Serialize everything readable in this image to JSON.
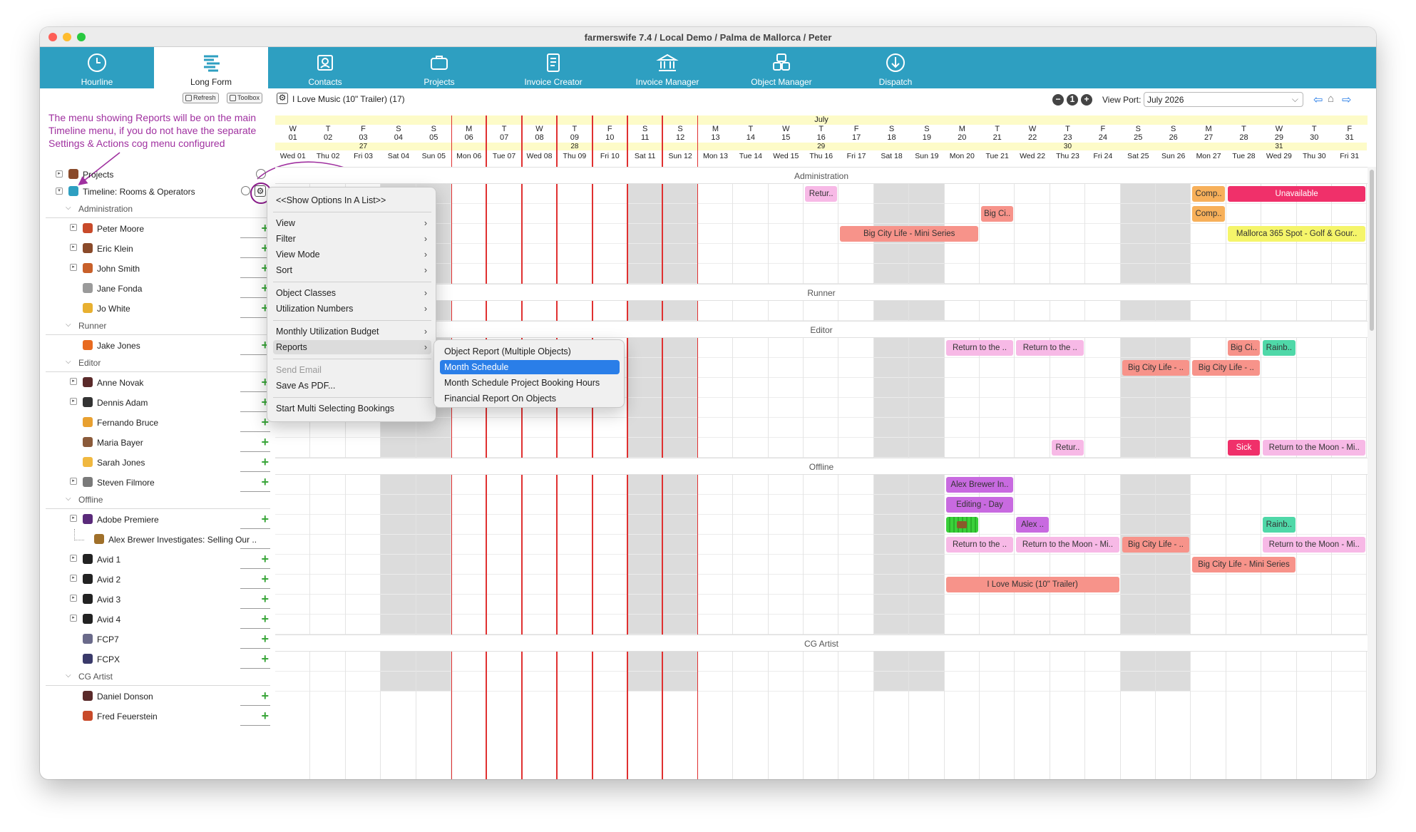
{
  "window": {
    "title": "farmerswife 7.4   / Local Demo / Palma de Mallorca / Peter"
  },
  "tabs": [
    {
      "label": "Hourline",
      "icon": "clock-icon",
      "active": false
    },
    {
      "label": "Long Form",
      "icon": "timeline-icon",
      "active": true
    },
    {
      "label": "Contacts",
      "icon": "contacts-icon",
      "active": false
    },
    {
      "label": "Projects",
      "icon": "briefcase-icon",
      "active": false
    },
    {
      "label": "Invoice Creator",
      "icon": "invoice-icon",
      "active": false
    },
    {
      "label": "Invoice Manager",
      "icon": "bank-icon",
      "active": false
    },
    {
      "label": "Object Manager",
      "icon": "objects-icon",
      "active": false
    },
    {
      "label": "Dispatch",
      "icon": "dispatch-icon",
      "active": false
    }
  ],
  "toolbar": {
    "refresh_label": "Refresh",
    "toolbox_label": "Toolbox",
    "project_label": "I Love Music (10\" Trailer) (17)",
    "viewport_label": "View Port:",
    "viewport_value": "July 2026"
  },
  "annotation": "The menu showing Reports will be on the main Timeline menu, if you do not have the separate Settings & Actions cog menu configured",
  "tree": {
    "projects_label": "Projects",
    "timeline_label": "Timeline: Rooms & Operators"
  },
  "rows": [
    {
      "type": "group",
      "label": "Administration"
    },
    {
      "type": "item",
      "label": "Peter Moore",
      "disc": true,
      "avatar": "#c84a2a"
    },
    {
      "type": "item",
      "label": "Eric Klein",
      "disc": true,
      "avatar": "#8a4a2a"
    },
    {
      "type": "item",
      "label": "John Smith",
      "disc": true,
      "avatar": "#c8602a"
    },
    {
      "type": "item",
      "label": "Jane Fonda",
      "disc": false,
      "avatar": "#9a9a9a"
    },
    {
      "type": "item",
      "label": "Jo White",
      "disc": false,
      "avatar": "#e8b030"
    },
    {
      "type": "group",
      "label": "Runner"
    },
    {
      "type": "item",
      "label": "Jake Jones",
      "disc": false,
      "avatar": "#e86a20"
    },
    {
      "type": "group",
      "label": "Editor"
    },
    {
      "type": "item",
      "label": "Anne Novak",
      "disc": true,
      "avatar": "#5a2a2a"
    },
    {
      "type": "item",
      "label": "Dennis Adam",
      "disc": true,
      "avatar": "#333333"
    },
    {
      "type": "item",
      "label": "Fernando Bruce",
      "disc": false,
      "avatar": "#e8a030"
    },
    {
      "type": "item",
      "label": "Maria Bayer",
      "disc": false,
      "avatar": "#8a5a3a"
    },
    {
      "type": "item",
      "label": "Sarah Jones",
      "disc": false,
      "avatar": "#f0b840"
    },
    {
      "type": "item",
      "label": "Steven Filmore",
      "disc": true,
      "avatar": "#7a7a7a"
    },
    {
      "type": "group",
      "label": "Offline"
    },
    {
      "type": "item",
      "label": "Adobe Premiere",
      "disc": true,
      "avatar": "#5a2a7a"
    },
    {
      "type": "sub",
      "label": "Alex Brewer Investigates: Selling Our ..",
      "disc": false,
      "avatar": "#a0702a"
    },
    {
      "type": "item",
      "label": "Avid 1",
      "disc": true,
      "avatar": "#222222"
    },
    {
      "type": "item",
      "label": "Avid 2",
      "disc": true,
      "avatar": "#222222"
    },
    {
      "type": "item",
      "label": "Avid 3",
      "disc": true,
      "avatar": "#222222"
    },
    {
      "type": "item",
      "label": "Avid 4",
      "disc": true,
      "avatar": "#222222"
    },
    {
      "type": "item",
      "label": "FCP7",
      "disc": false,
      "avatar": "#6a6a8a"
    },
    {
      "type": "item",
      "label": "FCPX",
      "disc": false,
      "avatar": "#3a3a6a"
    },
    {
      "type": "group",
      "label": "CG Artist"
    },
    {
      "type": "item",
      "label": "Daniel Donson",
      "disc": false,
      "avatar": "#5a2a2a"
    },
    {
      "type": "item",
      "label": "Fred Feuerstein",
      "disc": false,
      "avatar": "#c84a2a"
    }
  ],
  "calendar": {
    "month": "July",
    "days": [
      {
        "l": "W",
        "n": "01",
        "d": "Wed 01",
        "wk": "",
        "we": false,
        "red": false
      },
      {
        "l": "T",
        "n": "02",
        "d": "Thu 02",
        "wk": "",
        "we": false,
        "red": false
      },
      {
        "l": "F",
        "n": "03",
        "d": "Fri 03",
        "wk": "27",
        "we": false,
        "red": false
      },
      {
        "l": "S",
        "n": "04",
        "d": "Sat 04",
        "wk": "",
        "we": true,
        "red": false
      },
      {
        "l": "S",
        "n": "05",
        "d": "Sun 05",
        "wk": "",
        "we": true,
        "red": false
      },
      {
        "l": "M",
        "n": "06",
        "d": "Mon 06",
        "wk": "",
        "we": false,
        "red": true
      },
      {
        "l": "T",
        "n": "07",
        "d": "Tue 07",
        "wk": "",
        "we": false,
        "red": true
      },
      {
        "l": "W",
        "n": "08",
        "d": "Wed 08",
        "wk": "",
        "we": false,
        "red": true
      },
      {
        "l": "T",
        "n": "09",
        "d": "Thu 09",
        "wk": "28",
        "we": false,
        "red": true
      },
      {
        "l": "F",
        "n": "10",
        "d": "Fri 10",
        "wk": "",
        "we": false,
        "red": true
      },
      {
        "l": "S",
        "n": "11",
        "d": "Sat 11",
        "wk": "",
        "we": true,
        "red": true
      },
      {
        "l": "S",
        "n": "12",
        "d": "Sun 12",
        "wk": "",
        "we": true,
        "red": true
      },
      {
        "l": "M",
        "n": "13",
        "d": "Mon 13",
        "wk": "",
        "we": false,
        "red": false
      },
      {
        "l": "T",
        "n": "14",
        "d": "Tue 14",
        "wk": "",
        "we": false,
        "red": false
      },
      {
        "l": "W",
        "n": "15",
        "d": "Wed 15",
        "wk": "",
        "we": false,
        "red": false
      },
      {
        "l": "T",
        "n": "16",
        "d": "Thu 16",
        "wk": "29",
        "we": false,
        "red": false
      },
      {
        "l": "F",
        "n": "17",
        "d": "Fri 17",
        "wk": "",
        "we": false,
        "red": false
      },
      {
        "l": "S",
        "n": "18",
        "d": "Sat 18",
        "wk": "",
        "we": true,
        "red": false
      },
      {
        "l": "S",
        "n": "19",
        "d": "Sun 19",
        "wk": "",
        "we": true,
        "red": false
      },
      {
        "l": "M",
        "n": "20",
        "d": "Mon 20",
        "wk": "",
        "we": false,
        "red": false
      },
      {
        "l": "T",
        "n": "21",
        "d": "Tue 21",
        "wk": "",
        "we": false,
        "red": false
      },
      {
        "l": "W",
        "n": "22",
        "d": "Wed 22",
        "wk": "",
        "we": false,
        "red": false
      },
      {
        "l": "T",
        "n": "23",
        "d": "Thu 23",
        "wk": "30",
        "we": false,
        "red": false
      },
      {
        "l": "F",
        "n": "24",
        "d": "Fri 24",
        "wk": "",
        "we": false,
        "red": false
      },
      {
        "l": "S",
        "n": "25",
        "d": "Sat 25",
        "wk": "",
        "we": true,
        "red": false
      },
      {
        "l": "S",
        "n": "26",
        "d": "Sun 26",
        "wk": "",
        "we": true,
        "red": false
      },
      {
        "l": "M",
        "n": "27",
        "d": "Mon 27",
        "wk": "",
        "we": false,
        "red": false
      },
      {
        "l": "T",
        "n": "28",
        "d": "Tue 28",
        "wk": "",
        "we": false,
        "red": false
      },
      {
        "l": "W",
        "n": "29",
        "d": "Wed 29",
        "wk": "31",
        "we": false,
        "red": false
      },
      {
        "l": "T",
        "n": "30",
        "d": "Thu 30",
        "wk": "",
        "we": false,
        "red": false
      },
      {
        "l": "F",
        "n": "31",
        "d": "Fri 31",
        "wk": "",
        "we": false,
        "red": false
      }
    ],
    "group_labels": [
      "Administration",
      "Runner",
      "Editor",
      "Offline",
      "CG Artist"
    ]
  },
  "bookings": [
    {
      "row": 1,
      "start": 15,
      "span": 1,
      "text": "Retur..",
      "color": "#f7b9e6"
    },
    {
      "row": 1,
      "start": 26,
      "span": 1,
      "text": "Comp..",
      "color": "#f7b05a"
    },
    {
      "row": 1,
      "start": 27,
      "span": 4,
      "text": "Unavailable",
      "color": "#f0306a",
      "fg": "#ffffff"
    },
    {
      "row": 2,
      "start": 20,
      "span": 1,
      "text": "Big Ci..",
      "color": "#f7938a"
    },
    {
      "row": 2,
      "start": 26,
      "span": 1,
      "text": "Comp..",
      "color": "#f7b05a"
    },
    {
      "row": 3,
      "start": 16,
      "span": 4,
      "text": "Big City Life - Mini Series",
      "color": "#f7938a"
    },
    {
      "row": 3,
      "start": 27,
      "span": 4,
      "text": "Mallorca 365 Spot - Golf & Gour..",
      "color": "#f5f56a"
    },
    {
      "row": 9,
      "start": 19,
      "span": 2,
      "text": "Return to the ..",
      "color": "#f7b9e6"
    },
    {
      "row": 9,
      "start": 21,
      "span": 2,
      "text": "Return to the ..",
      "color": "#f7b9e6"
    },
    {
      "row": 9,
      "start": 27,
      "span": 1,
      "text": "Big Ci..",
      "color": "#f7938a"
    },
    {
      "row": 9,
      "start": 28,
      "span": 1,
      "text": "Rainb..",
      "color": "#4fd8a8"
    },
    {
      "row": 10,
      "start": 24,
      "span": 2,
      "text": "Big City Life - ..",
      "color": "#f7938a"
    },
    {
      "row": 10,
      "start": 26,
      "span": 2,
      "text": "Big City Life - ..",
      "color": "#f7938a"
    },
    {
      "row": 14,
      "start": 22,
      "span": 1,
      "text": "Retur..",
      "color": "#f7b9e6"
    },
    {
      "row": 14,
      "start": 27,
      "span": 1,
      "text": "Sick",
      "color": "#f0306a",
      "fg": "#ffffff"
    },
    {
      "row": 14,
      "start": 28,
      "span": 3,
      "text": "Return to the Moon - Mi..",
      "color": "#f7b9e6"
    },
    {
      "row": 16,
      "start": 19,
      "span": 2,
      "text": "Alex Brewer In..",
      "color": "#c86ae0"
    },
    {
      "row": 17,
      "start": 19,
      "span": 2,
      "text": "Editing - Day",
      "color": "#c86ae0"
    },
    {
      "row": 18,
      "start": 19,
      "span": 1,
      "text": "",
      "color": "#3ad03a",
      "icon": true
    },
    {
      "row": 18,
      "start": 21,
      "span": 1,
      "text": "Alex ..",
      "color": "#c86ae0"
    },
    {
      "row": 18,
      "start": 28,
      "span": 1,
      "text": "Rainb..",
      "color": "#4fd8a8"
    },
    {
      "row": 19,
      "start": 19,
      "span": 2,
      "text": "Return to the ..",
      "color": "#f7b9e6"
    },
    {
      "row": 19,
      "start": 21,
      "span": 3,
      "text": "Return to the Moon - Mi..",
      "color": "#f7b9e6"
    },
    {
      "row": 19,
      "start": 24,
      "span": 2,
      "text": "Big City Life - ..",
      "color": "#f7938a"
    },
    {
      "row": 19,
      "start": 28,
      "span": 3,
      "text": "Return to the Moon - Mi..",
      "color": "#f7b9e6"
    },
    {
      "row": 20,
      "start": 26,
      "span": 3,
      "text": "Big City Life - Mini Series",
      "color": "#f7938a"
    },
    {
      "row": 21,
      "start": 19,
      "span": 5,
      "text": "I Love Music (10\" Trailer)",
      "color": "#f7938a"
    }
  ],
  "cog_menu": {
    "items": [
      {
        "label": "<<Show Options In A List>>",
        "arrow": false,
        "dis": false
      },
      {
        "sep": true
      },
      {
        "label": "View",
        "arrow": true,
        "dis": false
      },
      {
        "label": "Filter",
        "arrow": true,
        "dis": false
      },
      {
        "label": "View Mode",
        "arrow": true,
        "dis": false
      },
      {
        "label": "Sort",
        "arrow": true,
        "dis": false
      },
      {
        "sep": true
      },
      {
        "label": "Object Classes",
        "arrow": true,
        "dis": false
      },
      {
        "label": "Utilization Numbers",
        "arrow": true,
        "dis": false
      },
      {
        "sep": true
      },
      {
        "label": "Monthly Utilization Budget",
        "arrow": true,
        "dis": false
      },
      {
        "label": "Reports",
        "arrow": true,
        "dis": false,
        "hl": true
      },
      {
        "sep": true
      },
      {
        "label": "Send Email",
        "arrow": false,
        "dis": true
      },
      {
        "label": "Save As PDF...",
        "arrow": false,
        "dis": false
      },
      {
        "sep": true
      },
      {
        "label": "Start Multi Selecting Bookings",
        "arrow": false,
        "dis": false
      }
    ]
  },
  "reports_submenu": {
    "items": [
      {
        "label": "Object Report (Multiple Objects)",
        "selected": false
      },
      {
        "label": "Month Schedule",
        "selected": true
      },
      {
        "label": "Month Schedule Project Booking Hours",
        "selected": false
      },
      {
        "label": "Financial Report On Objects",
        "selected": false
      }
    ]
  },
  "colors": {
    "tab_bar": "#2e9fc1",
    "accent": "#2a7ee8",
    "weekend": "#dcdcdc",
    "annotation": "#a031a0",
    "red_line": "#e03030"
  }
}
